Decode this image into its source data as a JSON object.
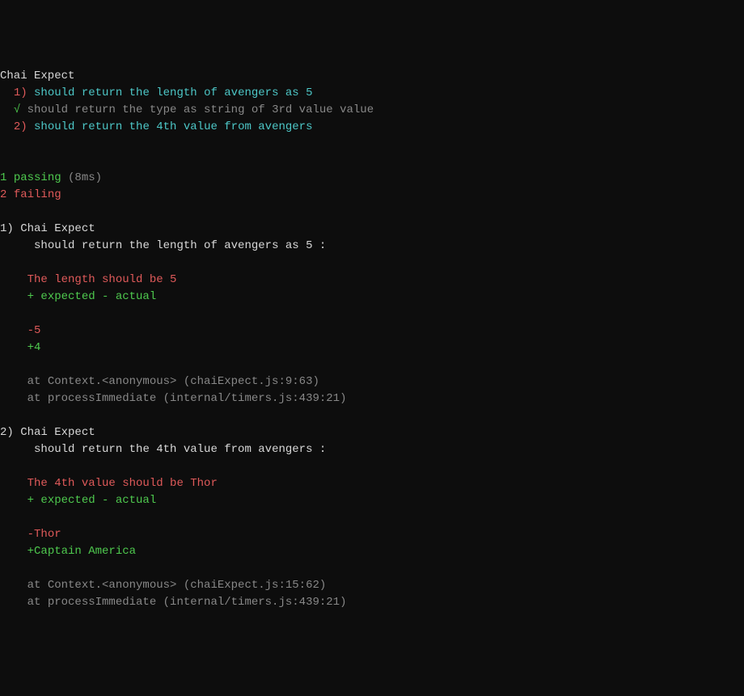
{
  "suite": {
    "name": "Chai Expect"
  },
  "tests": [
    {
      "marker": "1)",
      "desc": "should return the length of avengers as 5",
      "status": "fail"
    },
    {
      "marker": "√",
      "desc": "should return the type as string of 3rd value value",
      "status": "pass"
    },
    {
      "marker": "2)",
      "desc": "should return the 4th value from avengers",
      "status": "fail"
    }
  ],
  "summary": {
    "passingCount": "1",
    "passingWord": "passing",
    "passingTime": "(8ms)",
    "failingCount": "2",
    "failingWord": "failing"
  },
  "failures": [
    {
      "num": "1)",
      "suite": "Chai Expect",
      "test": "should return the length of avengers as 5 :",
      "message": "The length should be 5",
      "diffHeader": "+ expected - actual",
      "actual": "-5",
      "expected": "+4",
      "stack": [
        "at Context.<anonymous> (chaiExpect.js:9:63)",
        "at processImmediate (internal/timers.js:439:21)"
      ]
    },
    {
      "num": "2)",
      "suite": "Chai Expect",
      "test": "should return the 4th value from avengers :",
      "message": "The 4th value should be Thor",
      "diffHeader": "+ expected - actual",
      "actual": "-Thor",
      "expected": "+Captain America",
      "stack": [
        "at Context.<anonymous> (chaiExpect.js:15:62)",
        "at processImmediate (internal/timers.js:439:21)"
      ]
    }
  ]
}
